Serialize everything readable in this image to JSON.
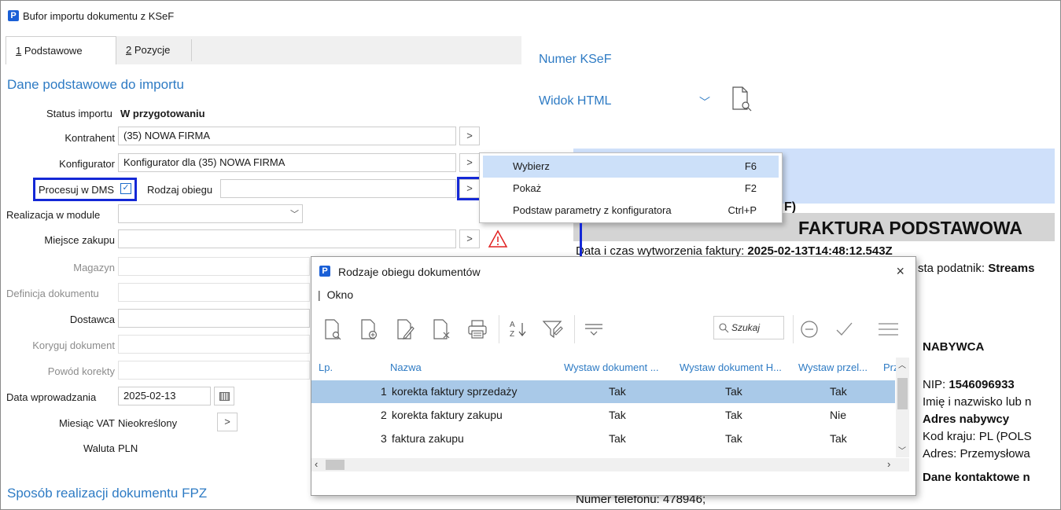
{
  "window": {
    "title": "Bufor importu dokumentu z KSeF",
    "app_icon": "P"
  },
  "tabs": [
    {
      "num": "1",
      "label": " Podstawowe"
    },
    {
      "num": "2",
      "label": " Pozycje"
    }
  ],
  "form": {
    "section_title": "Dane podstawowe do importu",
    "status_label": "Status importu",
    "status_value": "W przygotowaniu",
    "kontrahent_label": "Kontrahent",
    "kontrahent_value": "(35) NOWA FIRMA",
    "konfigurator_label": "Konfigurator",
    "konfigurator_value": "Konfigurator dla (35) NOWA FIRMA",
    "procesuj_label": "Procesuj w DMS",
    "procesuj_checked": true,
    "rodzaj_label": "Rodzaj obiegu",
    "rodzaj_value": "",
    "realizacja_label": "Realizacja w module",
    "realizacja_value": "",
    "miejsce_label": "Miejsce zakupu",
    "magazyn_label": "Magazyn",
    "definicja_label": "Definicja dokumentu",
    "dostawca_label": "Dostawca",
    "koryguj_label": "Koryguj dokument",
    "powod_label": "Powód korekty",
    "data_label": "Data wprowadzania",
    "data_value": "2025-02-13",
    "vat_label": "Miesiąc VAT",
    "vat_value": "Nieokreślony",
    "waluta_label": "Waluta",
    "waluta_value": "PLN",
    "section2_title": "Sposób realizacji dokumentu FPZ",
    "more_button": ">"
  },
  "preview": {
    "numer_label": "Numer KSeF",
    "widok_label": "Widok HTML",
    "frag_f": "F)",
    "heading": "FAKTURA PODSTAWOWA",
    "created_prefix": "Data i czas wytworzenia faktury: ",
    "created_value": "2025-02-13T14:48:12.543Z",
    "taxpayer_prefix": "sta podatnik: ",
    "taxpayer_value": "Streams",
    "nabywca": "NABYWCA",
    "nip_prefix": "NIP: ",
    "nip_value": "1546096933",
    "imie": "Imię i nazwisko lub n",
    "adres_nabywcy": "Adres nabywcy",
    "kod_kraju": "Kod kraju: PL  (POLS",
    "adres": "Adres: Przemysłowa",
    "dane_kontaktowe": "Dane kontaktowe n",
    "telefon": "Numer telefonu: 478946;"
  },
  "context_menu": {
    "items": [
      {
        "label": "Wybierz",
        "key": "F6"
      },
      {
        "label": "Pokaż",
        "key": "F2"
      },
      {
        "label": "Podstaw parametry z konfiguratora",
        "key": "Ctrl+P"
      }
    ]
  },
  "dialog": {
    "title": "Rodzaje obiegu dokumentów",
    "menu": "Okno",
    "search_placeholder": "Szukaj",
    "columns": [
      "Lp.",
      "Nazwa",
      "Wystaw dokument ...",
      "Wystaw dokument H...",
      "Wystaw przel...",
      "Prz"
    ],
    "rows": [
      {
        "lp": "1",
        "nazwa": "korekta faktury sprzedaży",
        "c1": "Tak",
        "c2": "Tak",
        "c3": "Tak"
      },
      {
        "lp": "2",
        "nazwa": "korekta faktury zakupu",
        "c1": "Tak",
        "c2": "Tak",
        "c3": "Nie"
      },
      {
        "lp": "3",
        "nazwa": "faktura zakupu",
        "c1": "Tak",
        "c2": "Tak",
        "c3": "Tak"
      }
    ],
    "close_glyph": "×"
  },
  "colors": {
    "accent": "#2e7bc4",
    "highlight": "#1428d6",
    "selected_row": "#a9c9e8",
    "menu_selected": "#cce0f9",
    "warning": "#e02020"
  }
}
